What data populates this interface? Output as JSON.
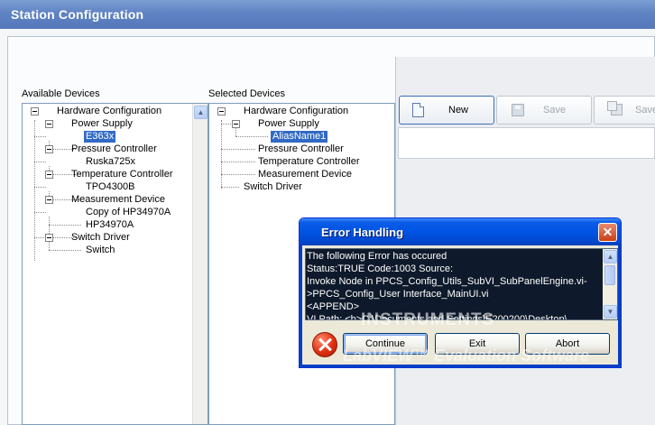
{
  "window": {
    "title": "Station Configuration"
  },
  "available": {
    "label": "Available Devices",
    "nodes": {
      "root": "Hardware Configuration",
      "power_supply": "Power Supply",
      "e363x": "E363x",
      "pressure_controller": "Pressure Controller",
      "ruska": "Ruska725x",
      "temperature_controller": "Temperature Controller",
      "tpo": "TPO4300B",
      "measurement_device": "Measurement Device",
      "copy_hp": "Copy of HP34970A",
      "hp": "HP34970A",
      "switch_driver": "Switch Driver",
      "switch": "Switch"
    }
  },
  "selected": {
    "label": "Selected Devices",
    "nodes": {
      "root": "Hardware Configuration",
      "power_supply": "Power Supply",
      "alias": "AliasName1",
      "pressure_controller": "Pressure Controller",
      "temperature_controller": "Temperature Controller",
      "measurement_device": "Measurement Device",
      "switch_driver": "Switch Driver"
    }
  },
  "toolbar": {
    "new_label": "New",
    "save_label": "Save",
    "save_as_label": "Save"
  },
  "dialog": {
    "title": "Error Handling",
    "close_glyph": "✕",
    "message_lines": [
      "The following Error has occured",
      "Status:TRUE  Code:1003  Source:",
      "Invoke Node in PPCS_Config_Utils_SubVI_SubPanelEngine.vi-",
      ">PPCS_Config_User Interface_MainUI.vi",
      "<APPEND>",
      "VI Path: <b>C:\\Documents and Settings\\E200200\\Desktop\\"
    ],
    "continue_label": "Continue",
    "exit_label": "Exit",
    "abort_label": "Abort"
  },
  "watermark": {
    "line1": "INSTRUMENTS",
    "line2": "LabVIEW™ Evaluation Software"
  },
  "scroll_up_glyph": "▲",
  "scroll_down_glyph": "▼"
}
